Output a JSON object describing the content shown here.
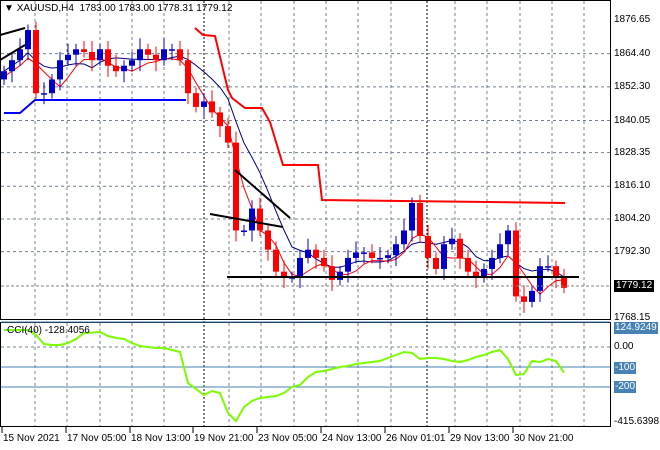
{
  "header": {
    "symbol": "XAUUSD,H4",
    "ohlc": "1783.00 1783.00 1778.31 1779.12"
  },
  "price_axis": {
    "labels": [
      "1876.65",
      "1864.40",
      "1852.30",
      "1840.05",
      "1828.35",
      "1816.10",
      "1804.20",
      "1792.30",
      "1768.15"
    ],
    "current": "1779.12"
  },
  "cci": {
    "title": "CCI(40) -128.4056",
    "axis": [
      "124.9249",
      "0.00",
      "-100",
      "-200",
      "-415.6398"
    ],
    "values": [
      85,
      85,
      85,
      85,
      60,
      15,
      10,
      10,
      20,
      40,
      70,
      72,
      75,
      55,
      45,
      40,
      20,
      5,
      0,
      -5,
      -5,
      -15,
      -25,
      -180,
      -210,
      -240,
      -220,
      -230,
      -330,
      -370,
      -300,
      -270,
      -255,
      -250,
      -245,
      -230,
      -200,
      -190,
      -150,
      -125,
      -120,
      -110,
      -100,
      -95,
      -85,
      -80,
      -75,
      -70,
      -55,
      -40,
      -25,
      -30,
      -60,
      -55,
      -55,
      -60,
      -70,
      -75,
      -65,
      -50,
      -40,
      -25,
      -15,
      -60,
      -140,
      -135,
      -70,
      -75,
      -60,
      -70,
      -128.4
    ]
  },
  "time_axis": [
    "15 Nov 2021",
    "17 Nov 05:00",
    "18 Nov 13:00",
    "19 Nov 21:00",
    "23 Nov 05:00",
    "24 Nov 13:00",
    "26 Nov 01:01",
    "29 Nov 13:00",
    "30 Nov 21:00"
  ],
  "colors": {
    "bull": "#0000cd",
    "bear": "#ff0000",
    "cci": "#7cfc00",
    "grid": "#708090"
  },
  "closes": [
    1858,
    1862,
    1866,
    1873,
    1850,
    1850,
    1855,
    1862,
    1864,
    1866,
    1865,
    1862,
    1866,
    1860,
    1858,
    1860,
    1862,
    1866,
    1864,
    1862,
    1866,
    1866,
    1862,
    1850,
    1845,
    1847,
    1843,
    1838,
    1832,
    1800,
    1800,
    1808,
    1800,
    1793,
    1785,
    1783,
    1783,
    1790,
    1793,
    1790,
    1787,
    1782,
    1785,
    1790,
    1792,
    1792,
    1790,
    1790,
    1791,
    1795,
    1800,
    1810,
    1798,
    1790,
    1786,
    1795,
    1797,
    1790,
    1785,
    1783,
    1786,
    1790,
    1795,
    1800,
    1776,
    1774,
    1778,
    1787,
    1787,
    1783,
    1779.12
  ]
}
